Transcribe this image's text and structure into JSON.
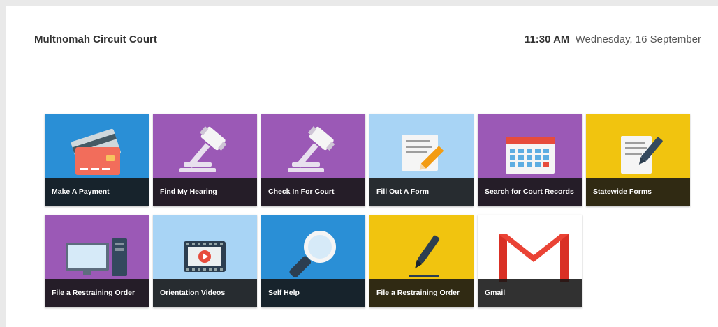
{
  "header": {
    "court_name": "Multnomah Circuit Court",
    "time": "11:30 AM",
    "date": "Wednesday, 16 September"
  },
  "tiles": [
    {
      "label": "Make A Payment",
      "icon": "credit-card-icon",
      "color": "#2a8fd6"
    },
    {
      "label": "Find My Hearing",
      "icon": "gavel-icon",
      "color": "#9b59b6"
    },
    {
      "label": "Check In For Court",
      "icon": "gavel-icon",
      "color": "#9b59b6"
    },
    {
      "label": "Fill Out A Form",
      "icon": "form-pencil-icon",
      "color": "#a8d4f5"
    },
    {
      "label": "Search for Court Records",
      "icon": "calendar-icon",
      "color": "#9b59b6"
    },
    {
      "label": "Statewide Forms",
      "icon": "document-pen-icon",
      "color": "#f1c40f"
    },
    {
      "label": "File a Restraining Order",
      "icon": "computer-icon",
      "color": "#9b59b6"
    },
    {
      "label": "Orientation Videos",
      "icon": "video-player-icon",
      "color": "#a8d4f5"
    },
    {
      "label": "Self Help",
      "icon": "magnifier-icon",
      "color": "#2a8fd6"
    },
    {
      "label": "File a Restraining Order",
      "icon": "pen-icon",
      "color": "#f1c40f"
    },
    {
      "label": "Gmail",
      "icon": "gmail-icon",
      "color": "#ffffff"
    }
  ]
}
